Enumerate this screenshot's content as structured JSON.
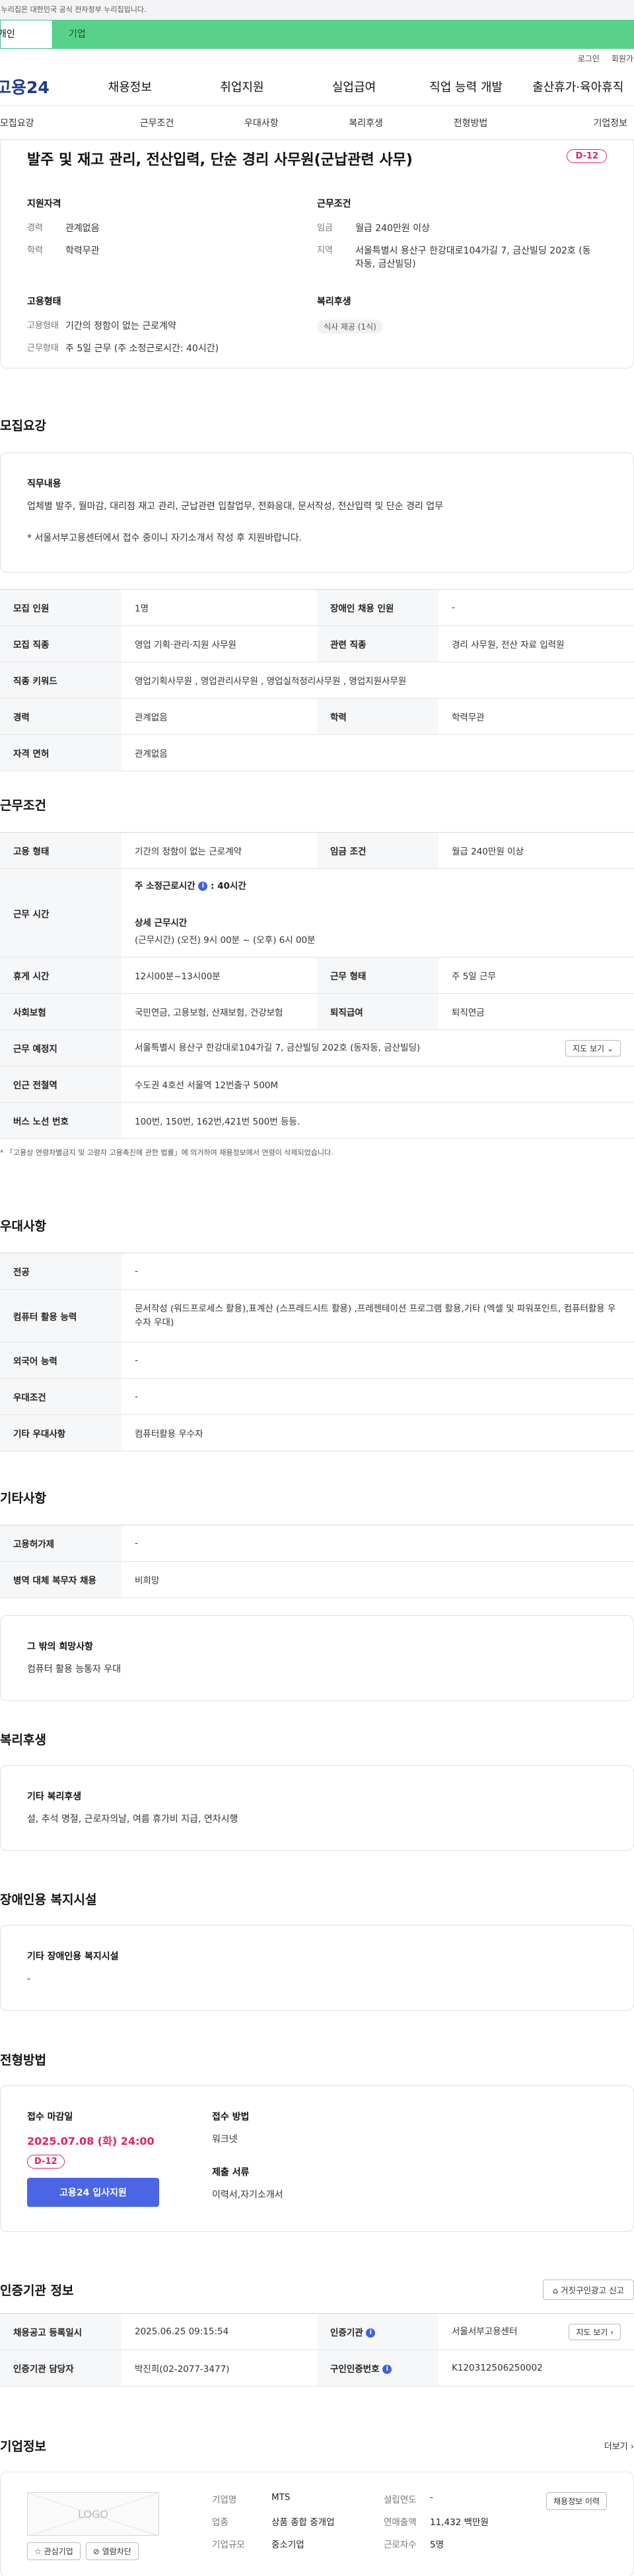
{
  "gov_banner": "이 누리집은 대한민국 공식 전자정부 누리집입니다.",
  "user_tabs": [
    "개인",
    "기업"
  ],
  "top_links": [
    "로그인",
    "회원가입"
  ],
  "logo": "고용24",
  "gnb": [
    "채용정보",
    "취업지원",
    "실업급여",
    "직업 능력 개발",
    "출산휴가·육아휴직"
  ],
  "snb": [
    "모집요강",
    "근무조건",
    "우대사항",
    "복리후생",
    "전형방법",
    "기업정보"
  ],
  "job": {
    "title": "발주 및 재고 관리, 전산입력, 단순 경리 사무원(군납관련 사무)",
    "dday": "D-12",
    "summary": {
      "qual_head": "지원자격",
      "qual": [
        {
          "k": "경력",
          "v": "관계없음"
        },
        {
          "k": "학력",
          "v": "학력무관"
        }
      ],
      "cond_head": "근무조건",
      "cond": [
        {
          "k": "임금",
          "v": "월급 240만원 이상"
        },
        {
          "k": "지역",
          "v": "서울특별시 용산구 한강대로104가길 7, 금산빌딩 202호 (동자동, 금산빌딩)"
        }
      ],
      "emp_head": "고용형태",
      "emp": [
        {
          "k": "고용형태",
          "v": "기간의 정함이 없는 근로계약"
        },
        {
          "k": "근무형태",
          "v": "주 5일 근무 (주 소정근로시간: 40시간)"
        }
      ],
      "welfare_head": "복리후생",
      "welfare_tag": "식사 제공 (1식)"
    }
  },
  "recruit": {
    "title": "모집요강",
    "duty_head": "직무내용",
    "duty_text": "업체별 발주, 월마감, 대리점 재고 관리, 군납관련 입찰업무, 전화응대, 문서작성, 전산입력 및 단순 경리 업무",
    "duty_note": "* 서울서부고용센터에서 접수 중이니 자기소개서 작성 후 지원바랍니다.",
    "rows": [
      [
        {
          "th": "모집 인원"
        },
        {
          "td": "1명"
        },
        {
          "th": "장애인 채용 인원"
        },
        {
          "td": "-"
        }
      ],
      [
        {
          "th": "모집 직종"
        },
        {
          "td": "영업 기획·관리·지원 사무원"
        },
        {
          "th": "관련 직종"
        },
        {
          "td": "경리 사무원, 전산 자료 입력원"
        }
      ],
      [
        {
          "th": "직종 키워드"
        },
        {
          "td": "영업기획사무원 , 영업관리사무원 , 영업실적정리사무원 , 영업지원사무원",
          "span": 3
        }
      ],
      [
        {
          "th": "경력"
        },
        {
          "td": "관계없음"
        },
        {
          "th": "학력"
        },
        {
          "td": "학력무관"
        }
      ],
      [
        {
          "th": "자격 면허"
        },
        {
          "td": "관계없음",
          "span": 3
        }
      ]
    ]
  },
  "work": {
    "title": "근무조건",
    "emp_type_th": "고용 형태",
    "emp_type": "기간의 정함이 없는 근로계약",
    "wage_th": "임금 조건",
    "wage": "월급 240만원 이상",
    "hours_th": "근무 시간",
    "hours_weekly": "주 소정근로시간",
    "hours_weekly_val": ": 40시간",
    "hours_detail_head": "상세 근무시간",
    "hours_detail": "(근무시간) (오전) 9시 00분 ~ (오후) 6시 00분",
    "rest_th": "휴게 시간",
    "rest": "12시00분~13시00분",
    "work_form_th": "근무 형태",
    "work_form": "주 5일 근무",
    "insurance_th": "사회보험",
    "insurance": "국민연금, 고용보험, 산재보험, 건강보험",
    "retire_th": "퇴직급여",
    "retire": "퇴직연금",
    "place_th": "근무 예정지",
    "place": "서울특별시 용산구 한강대로104가길 7, 금산빌딩 202호 (동자동, 금산빌딩)",
    "map_btn": "지도 보기",
    "subway_th": "인근 전철역",
    "subway": "수도권 4호선 서울역 12번출구 500M",
    "bus_th": "버스 노선 번호",
    "bus": "100번, 150번, 162번,421번 500번 등등.",
    "note": "* 「고용상 연령차별금지 및 고령자 고용촉진에 관한 법률」에 의거하여 채용정보에서 연령이 삭제되었습니다."
  },
  "pref": {
    "title": "우대사항",
    "rows": [
      {
        "th": "전공",
        "td": "-"
      },
      {
        "th": "컴퓨터 활용 능력",
        "td": "문서작성 (워드프로세스 활용),표계산 (스프레드시트 활용) ,프레젠테이션 프로그램 활용,기타 (엑셀 및 파워포인트, 컴퓨터활용 우수자 우대)"
      },
      {
        "th": "외국어 능력",
        "td": "-"
      },
      {
        "th": "우대조건",
        "td": "-"
      },
      {
        "th": "기타 우대사항",
        "td": "컴퓨터활용 우수자"
      }
    ]
  },
  "etc": {
    "title": "기타사항",
    "rows": [
      {
        "th": "고용허가제",
        "td": "-"
      },
      {
        "th": "병역 대체 복무자 채용",
        "td": "비희망"
      }
    ],
    "hope_head": "그 밖의 희망사항",
    "hope": "컴퓨터 활용 능통자 우대"
  },
  "welfare": {
    "title": "복리후생",
    "head": "기타 복리후생",
    "text": "설, 추석 명절, 근로자의날, 여름 휴가비 지급, 연차시행"
  },
  "disabled": {
    "title": "장애인용 복지시설",
    "head": "기타 장애인용 복지시설",
    "text": "-"
  },
  "process": {
    "title": "전형방법",
    "deadline_head": "접수 마감일",
    "deadline": "2025.07.08 (화) 24:00",
    "dday": "D-12",
    "apply_btn": "고용24 입사지원",
    "method_head": "접수 방법",
    "method": "워크넷",
    "docs_head": "제출 서류",
    "docs": "이력서,자기소개서"
  },
  "cert": {
    "title": "인증기관 정보",
    "report_btn": "거짓구인광고 신고",
    "reg_th": "채용공고 등록일시",
    "reg": "2025.06.25 09:15:54",
    "org_th": "인증기관",
    "org": "서울서부고용센터",
    "map_btn": "지도 보기",
    "mgr_th": "인증기관 담당자",
    "mgr": "박진희(02-2077-3477)",
    "no_th": "구인인증번호",
    "no": "K120312506250002"
  },
  "company": {
    "title": "기업정보",
    "more": "더보기",
    "logo": "LOGO",
    "fav_btn": "관심기업",
    "block_btn": "열람차단",
    "fields": [
      {
        "k": "기업명",
        "v": "MTS"
      },
      {
        "k": "설립연도",
        "v": "-"
      },
      {
        "k": "업종",
        "v": "상품 종합 중개업"
      },
      {
        "k": "연매출액",
        "v": "11,432 백만원"
      },
      {
        "k": "기업규모",
        "v": "중소기업"
      },
      {
        "k": "근로자수",
        "v": "5명"
      }
    ],
    "jobs_btn": "채용정보 이력"
  }
}
